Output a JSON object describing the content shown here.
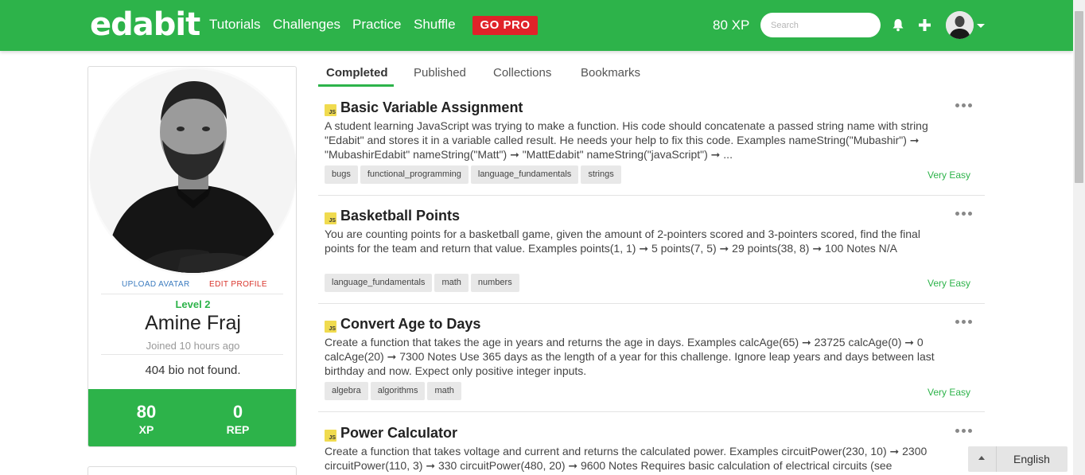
{
  "nav": {
    "brand": "edabit",
    "links": [
      "Tutorials",
      "Challenges",
      "Practice",
      "Shuffle"
    ],
    "go_pro": "GO PRO",
    "xp": "80 XP",
    "search_placeholder": "Search"
  },
  "profile": {
    "upload_avatar": "UPLOAD AVATAR",
    "edit_profile": "EDIT PROFILE",
    "level": "Level 2",
    "name": "Amine Fraj",
    "joined": "Joined 10 hours ago",
    "bio": "404 bio not found.",
    "xp_value": "80",
    "xp_label": "XP",
    "rep_value": "0",
    "rep_label": "REP"
  },
  "tabs": [
    "Completed",
    "Published",
    "Collections",
    "Bookmarks"
  ],
  "active_tab": "Completed",
  "challenges": [
    {
      "lang_badge": "JS",
      "title": "Basic Variable Assignment",
      "description": "A student learning JavaScript was trying to make a function. His code should concatenate a passed string name with string \"Edabit\" and stores it in a variable called result. He needs your help to fix this code. Examples nameString(\"Mubashir\") ➞ \"MubashirEdabit\" nameString(\"Matt\") ➞ \"MattEdabit\" nameString(\"javaScript\") ➞ ...",
      "tags": [
        "bugs",
        "functional_programming",
        "language_fundamentals",
        "strings"
      ],
      "difficulty": "Very Easy"
    },
    {
      "lang_badge": "JS",
      "title": "Basketball Points",
      "description": "You are counting points for a basketball game, given the amount of 2-pointers scored and 3-pointers scored, find the final points for the team and return that value. Examples points(1, 1) ➞ 5 points(7, 5) ➞ 29 points(38, 8) ➞ 100 Notes N/A",
      "tags": [
        "language_fundamentals",
        "math",
        "numbers"
      ],
      "difficulty": "Very Easy"
    },
    {
      "lang_badge": "JS",
      "title": "Convert Age to Days",
      "description": "Create a function that takes the age in years and returns the age in days. Examples calcAge(65) ➞ 23725 calcAge(0) ➞ 0 calcAge(20) ➞ 7300 Notes Use 365 days as the length of a year for this challenge. Ignore leap years and days between last birthday and now. Expect only positive integer inputs.",
      "tags": [
        "algebra",
        "algorithms",
        "math"
      ],
      "difficulty": "Very Easy"
    },
    {
      "lang_badge": "JS",
      "title": "Power Calculator",
      "description": "Create a function that takes voltage and current and returns the calculated power. Examples circuitPower(230, 10) ➞ 2300 circuitPower(110, 3) ➞ 330 circuitPower(480, 20) ➞ 9600 Notes Requires basic calculation of electrical circuits (see Resources for info).",
      "tags": [],
      "difficulty": ""
    }
  ],
  "language": "English",
  "colors": {
    "brand_green": "#2db34a",
    "go_pro_red": "#e02229"
  },
  "icons": [
    "bell-icon",
    "plus-icon",
    "caret-down-icon",
    "more-icon",
    "js-icon",
    "chevron-up-icon"
  ]
}
